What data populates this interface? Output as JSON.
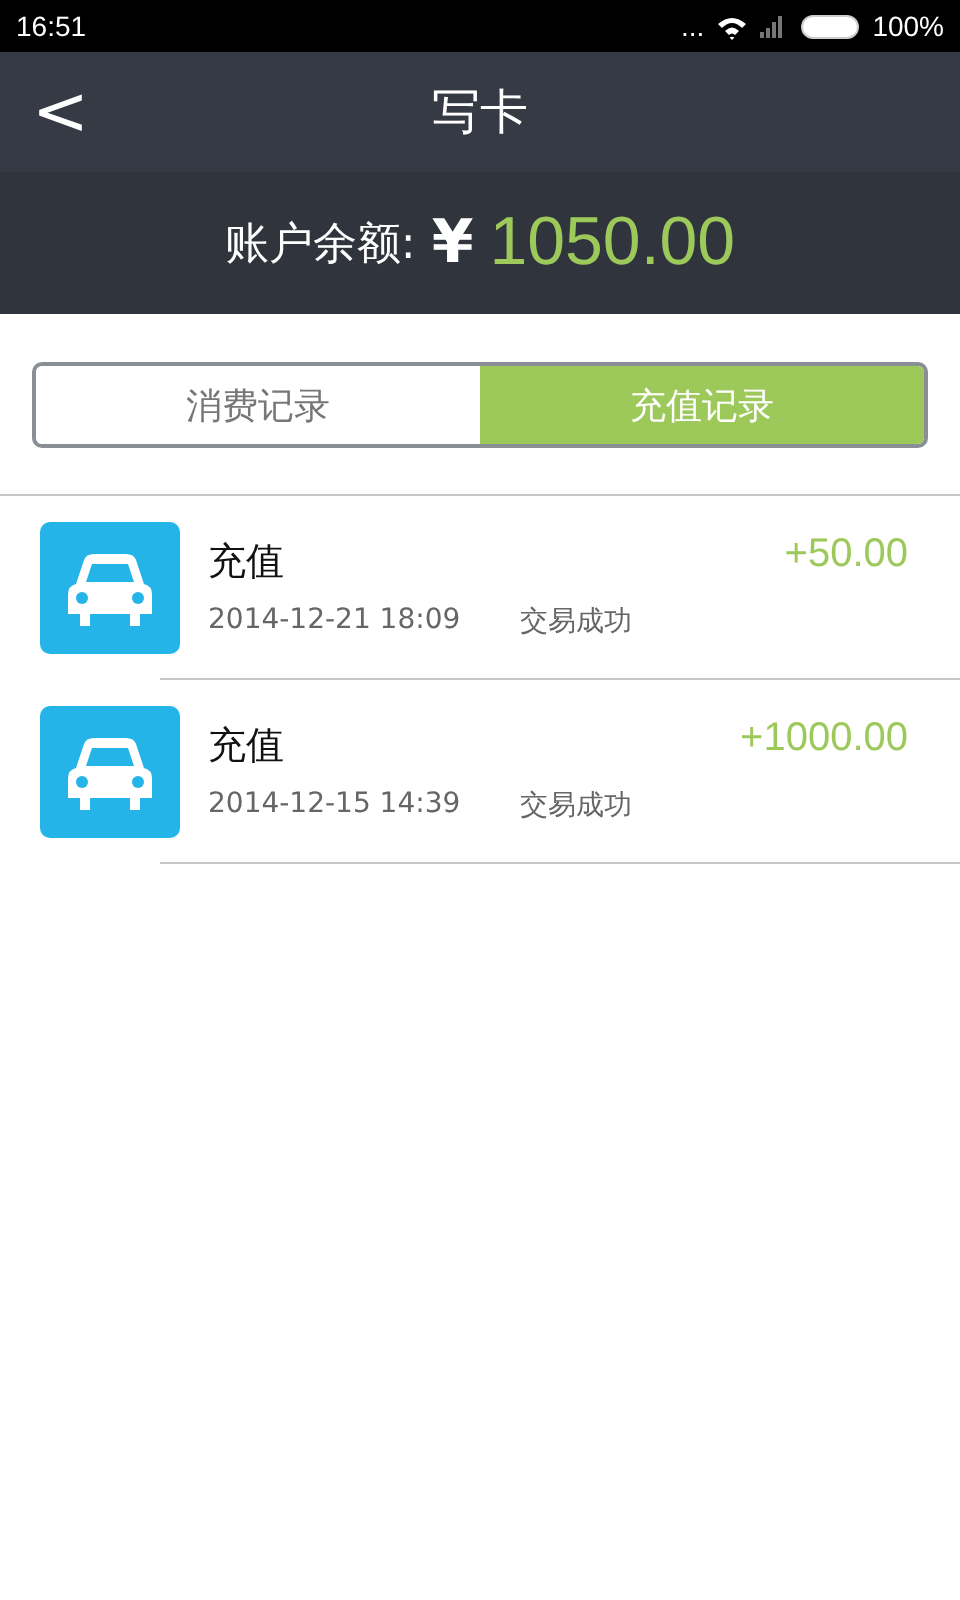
{
  "status_bar": {
    "time": "16:51",
    "more": "...",
    "battery": "100%"
  },
  "header": {
    "back": "<",
    "title": "写卡"
  },
  "balance": {
    "label": "账户余额:",
    "currency": "¥",
    "amount": "1050.00"
  },
  "tabs": [
    {
      "label": "消费记录",
      "selected": false
    },
    {
      "label": "充值记录",
      "selected": true
    }
  ],
  "records": [
    {
      "title": "充值",
      "time": "2014-12-21 18:09",
      "status": "交易成功",
      "amount": "+50.00"
    },
    {
      "title": "充值",
      "time": "2014-12-15 14:39",
      "status": "交易成功",
      "amount": "+1000.00"
    }
  ]
}
